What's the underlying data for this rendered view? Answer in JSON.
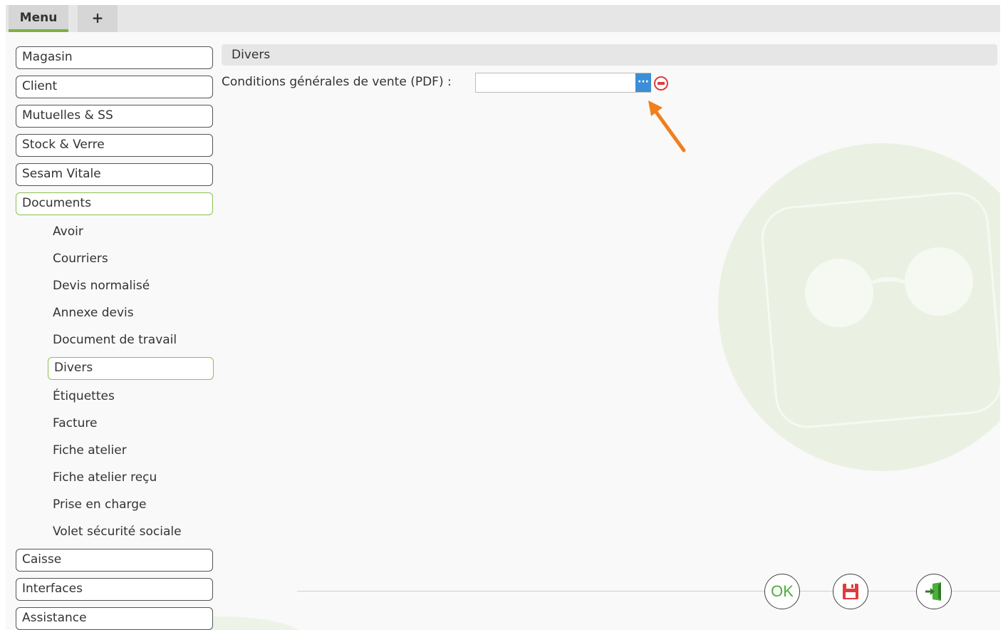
{
  "tabs": {
    "menu_label": "Menu",
    "add_label": "+"
  },
  "sidebar": {
    "items_top": [
      "Magasin",
      "Client",
      "Mutuelles & SS",
      "Stock & Verre",
      "Sesam Vitale",
      "Documents"
    ],
    "sub_items": [
      "Avoir",
      "Courriers",
      "Devis normalisé",
      "Annexe devis",
      "Document de travail",
      "Divers",
      "Étiquettes",
      "Facture",
      "Fiche atelier",
      "Fiche atelier reçu",
      "Prise en charge",
      "Volet sécurité sociale"
    ],
    "items_bottom": [
      "Caisse",
      "Interfaces",
      "Assistance"
    ]
  },
  "main": {
    "section_title": "Divers",
    "field_label": "Conditions générales de vente (PDF) :",
    "field_value": "",
    "browse_label": "···"
  },
  "actions": {
    "ok_label": "OK"
  },
  "colors": {
    "accent": "#8cc152",
    "browse": "#3a8fd6",
    "remove": "#e03c3c",
    "arrow": "#f07f1e",
    "save": "#e03c3c",
    "exit": "#4caf3a"
  }
}
